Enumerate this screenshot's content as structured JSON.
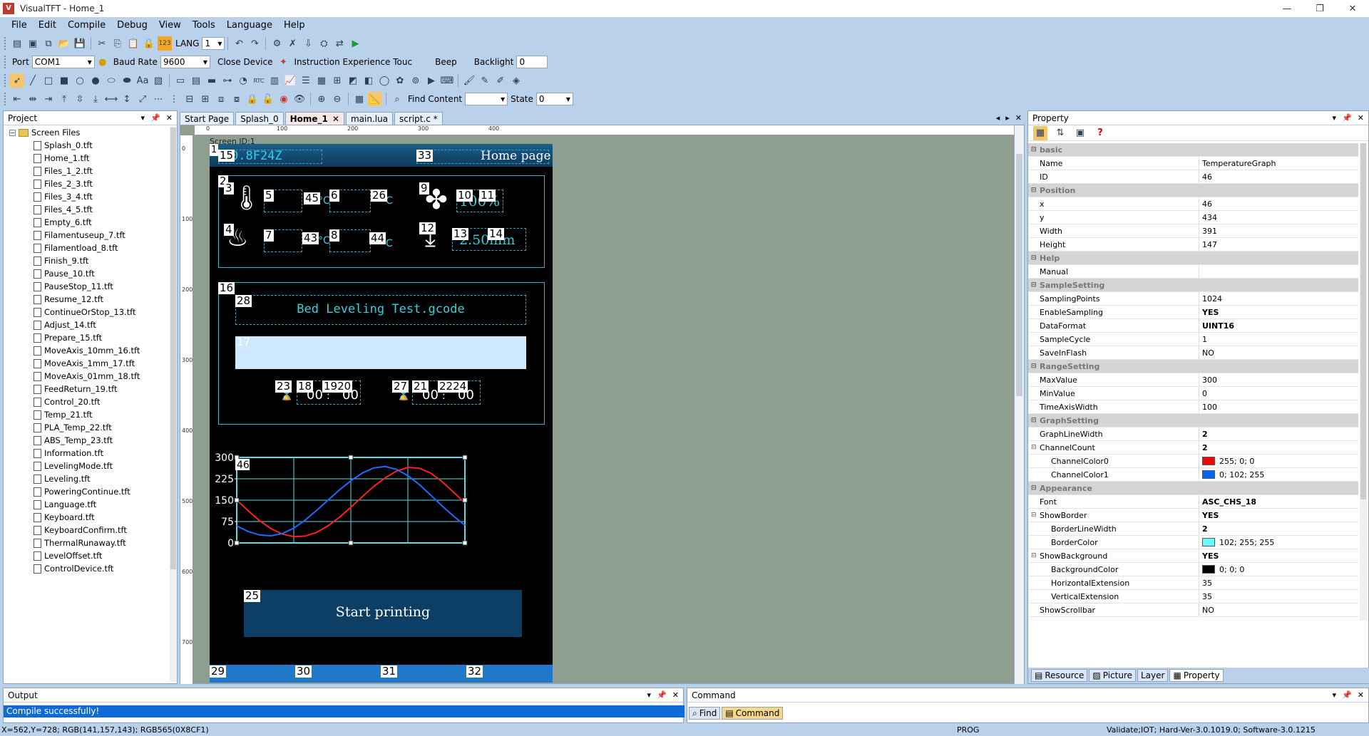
{
  "window": {
    "title": "VisualTFT - Home_1",
    "logo": "V"
  },
  "menu": [
    "File",
    "Edit",
    "Compile",
    "Debug",
    "View",
    "Tools",
    "Language",
    "Help"
  ],
  "toolbar1": {
    "lang_label": "LANG",
    "lang_value": "1"
  },
  "toolbar2": {
    "port_label": "Port",
    "port_value": "COM1",
    "baud_label": "Baud Rate",
    "baud_value": "9600",
    "close_label": "Close Device",
    "instr_label": "Instruction Experience Touc",
    "beep_label": "Beep",
    "backlight_label": "Backlight",
    "backlight_value": "0"
  },
  "toolbar3": {
    "find_label": "Find Content",
    "state_label": "State",
    "state_value": "0"
  },
  "project": {
    "title": "Project",
    "root": "Screen Files",
    "files": [
      "Splash_0.tft",
      "Home_1.tft",
      "Files_1_2.tft",
      "Files_2_3.tft",
      "Files_3_4.tft",
      "Files_4_5.tft",
      "Empty_6.tft",
      "Filamentuseup_7.tft",
      "Filamentload_8.tft",
      "Finish_9.tft",
      "Pause_10.tft",
      "PauseStop_11.tft",
      "Resume_12.tft",
      "ContinueOrStop_13.tft",
      "Adjust_14.tft",
      "Prepare_15.tft",
      "MoveAxis_10mm_16.tft",
      "MoveAxis_1mm_17.tft",
      "MoveAxis_01mm_18.tft",
      "FeedReturn_19.tft",
      "Control_20.tft",
      "Temp_21.tft",
      "PLA_Temp_22.tft",
      "ABS_Temp_23.tft",
      "Information.tft",
      "LevelingMode.tft",
      "Leveling.tft",
      "PoweringContinue.tft",
      "Language.tft",
      "Keyboard.tft",
      "KeyboardConfirm.tft",
      "ThermalRunaway.tft",
      "LevelOffset.tft",
      "ControlDevice.tft"
    ]
  },
  "doctabs": [
    {
      "label": "Start Page"
    },
    {
      "label": "Splash_0"
    },
    {
      "label": "Home_1",
      "active": true
    },
    {
      "label": "main.lua"
    },
    {
      "label": "script.c *"
    }
  ],
  "ruler": {
    "h": [
      "0",
      "100",
      "200",
      "300",
      "400"
    ],
    "v": [
      "0",
      "100",
      "200",
      "300",
      "400",
      "500",
      "600",
      "700"
    ]
  },
  "screen": {
    "label": "Screen ID:1",
    "header_id": "0.8F24Z",
    "home_page": "Home page",
    "file_name": "Bed Leveling Test.gcode",
    "start_button": "Start printing",
    "fan_text": "100%",
    "z_text": "2.50mm",
    "nums": {
      "n1": "1",
      "n15": "15",
      "n33": "33",
      "n2": "2",
      "n3": "3",
      "n5": "5",
      "n45": "45",
      "n6": "6",
      "n26": "26",
      "n9": "9",
      "n10": "10",
      "n11": "11",
      "n4": "4",
      "n7": "7",
      "n43": "43",
      "n8": "8",
      "n44": "44",
      "n12": "12",
      "n13": "13",
      "n14": "14",
      "n16": "16",
      "n28": "28",
      "n17": "17",
      "n23": "23",
      "n18": "18",
      "n1920": "1920",
      "n27": "27",
      "n21": "21",
      "n2224": "2224",
      "n46": "46",
      "n25": "25",
      "n29": "29",
      "n30": "30",
      "n31": "31",
      "n32": "32"
    },
    "digits": "00",
    "colon": ":",
    "temp_unit": "°C"
  },
  "chart_data": {
    "type": "line",
    "ylim": [
      0,
      300
    ],
    "yticks": [
      "300",
      "225",
      "150",
      "75",
      "0"
    ],
    "x": [
      0,
      1,
      2,
      3,
      4,
      5,
      6,
      7,
      8,
      9,
      10,
      11,
      12,
      13,
      14,
      15,
      16,
      17,
      18,
      19,
      20
    ],
    "series": [
      {
        "color": "#ff2020",
        "values": [
          150,
          113,
          78,
          50,
          31,
          22,
          24,
          37,
          60,
          90,
          125,
          162,
          198,
          228,
          252,
          265,
          262,
          245,
          215,
          178,
          140
        ]
      },
      {
        "color": "#1e6cff",
        "values": [
          60,
          40,
          28,
          25,
          33,
          52,
          80,
          114,
          150,
          186,
          218,
          245,
          263,
          268,
          258,
          236,
          205,
          168,
          130,
          94,
          62
        ]
      }
    ]
  },
  "property": {
    "title": "Property",
    "rows": [
      {
        "cat": true,
        "name": "basic"
      },
      {
        "name": "Name",
        "value": "TemperatureGraph"
      },
      {
        "name": "ID",
        "value": "46"
      },
      {
        "cat": true,
        "name": "Position"
      },
      {
        "name": "x",
        "value": "46"
      },
      {
        "name": "y",
        "value": "434"
      },
      {
        "name": "Width",
        "value": "391"
      },
      {
        "name": "Height",
        "value": "147"
      },
      {
        "cat": true,
        "name": "Help"
      },
      {
        "name": "Manual",
        "value": ""
      },
      {
        "cat": true,
        "name": "SampleSetting"
      },
      {
        "name": "SamplingPoints",
        "value": "1024"
      },
      {
        "name": "EnableSampling",
        "value": "YES",
        "bold": true
      },
      {
        "name": "DataFormat",
        "value": "UINT16",
        "bold": true
      },
      {
        "name": "SampleCycle",
        "value": "1"
      },
      {
        "name": "SaveInFlash",
        "value": "NO"
      },
      {
        "cat": true,
        "name": "RangeSetting"
      },
      {
        "name": "MaxValue",
        "value": "300"
      },
      {
        "name": "MinValue",
        "value": "0"
      },
      {
        "name": "TimeAxisWidth",
        "value": "100"
      },
      {
        "cat": true,
        "name": "GraphSetting"
      },
      {
        "name": "GraphLineWidth",
        "value": "2",
        "bold": true
      },
      {
        "name": "ChannelCount",
        "value": "2",
        "bold": true,
        "expand": true
      },
      {
        "name": "ChannelColor0",
        "value": "255; 0; 0",
        "sub": true,
        "swatch": "#ff0000"
      },
      {
        "name": "ChannelColor1",
        "value": "0; 102; 255",
        "sub": true,
        "swatch": "#0066ff"
      },
      {
        "cat": true,
        "name": "Appearance"
      },
      {
        "name": "Font",
        "value": "ASC_CHS_18",
        "bold": true
      },
      {
        "name": "ShowBorder",
        "value": "YES",
        "bold": true,
        "expand": true
      },
      {
        "name": "BorderLineWidth",
        "value": "2",
        "sub": true,
        "bold": true
      },
      {
        "name": "BorderColor",
        "value": "102; 255; 255",
        "sub": true,
        "swatch": "#66ffff"
      },
      {
        "name": "ShowBackground",
        "value": "YES",
        "bold": true,
        "expand": true
      },
      {
        "name": "BackgroundColor",
        "value": "0; 0; 0",
        "sub": true,
        "swatch": "#000000"
      },
      {
        "name": "HorizontalExtension",
        "value": "35",
        "sub": true
      },
      {
        "name": "VerticalExtension",
        "value": "35",
        "sub": true
      },
      {
        "name": "ShowScrollbar",
        "value": "NO"
      }
    ]
  },
  "bottomtabs": [
    "Resource",
    "Picture",
    "Layer",
    "Property"
  ],
  "output": {
    "title": "Output",
    "message": "Compile successfully!"
  },
  "command": {
    "title": "Command",
    "tabs": [
      "Find",
      "Command"
    ]
  },
  "status": {
    "coords": "X=562,Y=728; RGB(141,157,143); RGB565(0X8CF1)",
    "mode": "PROG",
    "version": "Validate;IOT; Hard-Ver-3.0.1019.0; Software-3.0.1215"
  }
}
